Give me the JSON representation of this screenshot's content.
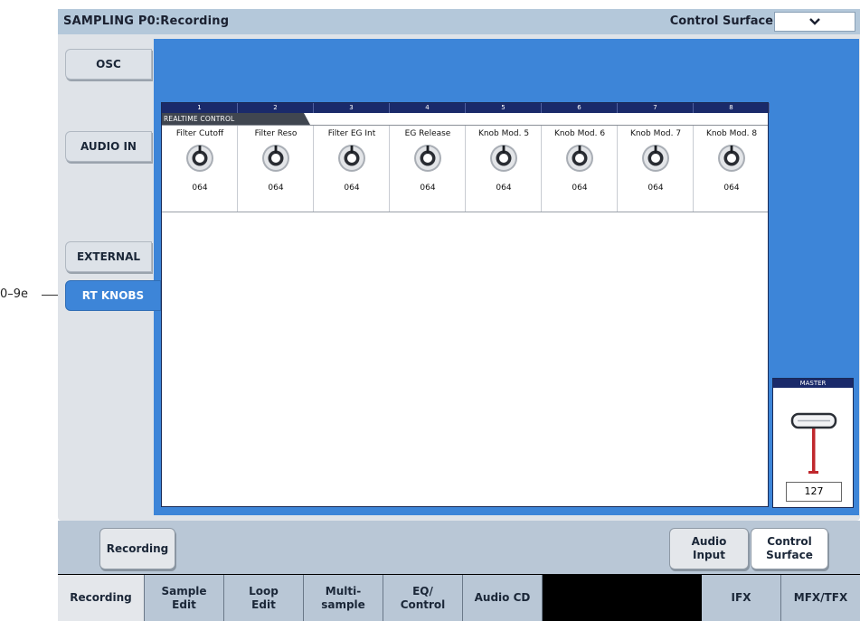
{
  "callout": "0–9e",
  "title": {
    "mode_page": "SAMPLING P0:Recording",
    "page_name": "Control Surface",
    "menu_icon": "chevron-down-icon"
  },
  "side_tabs": [
    {
      "label": "OSC"
    },
    {
      "label": "AUDIO IN"
    },
    {
      "label": "EXTERNAL"
    },
    {
      "label": "RT KNOBS"
    }
  ],
  "knob_panel": {
    "columns": [
      "1",
      "2",
      "3",
      "4",
      "5",
      "6",
      "7",
      "8"
    ],
    "section_label": "REALTIME CONTROL",
    "knobs": [
      {
        "name": "Filter Cutoff",
        "value": "064"
      },
      {
        "name": "Filter Reso",
        "value": "064"
      },
      {
        "name": "Filter EG Int",
        "value": "064"
      },
      {
        "name": "EG Release",
        "value": "064"
      },
      {
        "name": "Knob Mod. 5",
        "value": "064"
      },
      {
        "name": "Knob Mod. 6",
        "value": "064"
      },
      {
        "name": "Knob Mod. 7",
        "value": "064"
      },
      {
        "name": "Knob Mod. 8",
        "value": "064"
      }
    ]
  },
  "master": {
    "label": "MASTER",
    "value": "127"
  },
  "sub_tabs": [
    {
      "label": "Recording"
    },
    {
      "label": "Audio\nInput"
    },
    {
      "label": "Control\nSurface"
    }
  ],
  "bottom_tabs": [
    {
      "label": "Recording"
    },
    {
      "label": "Sample\nEdit"
    },
    {
      "label": "Loop\nEdit"
    },
    {
      "label": "Multi-\nsample"
    },
    {
      "label": "EQ/\nControl"
    },
    {
      "label": "Audio CD"
    },
    {
      "label": "IFX"
    },
    {
      "label": "MFX/TFX"
    }
  ],
  "colors": {
    "accent_blue": "#3d85d8",
    "header_navy": "#1a2a6a",
    "fader_red": "#c0282d"
  }
}
